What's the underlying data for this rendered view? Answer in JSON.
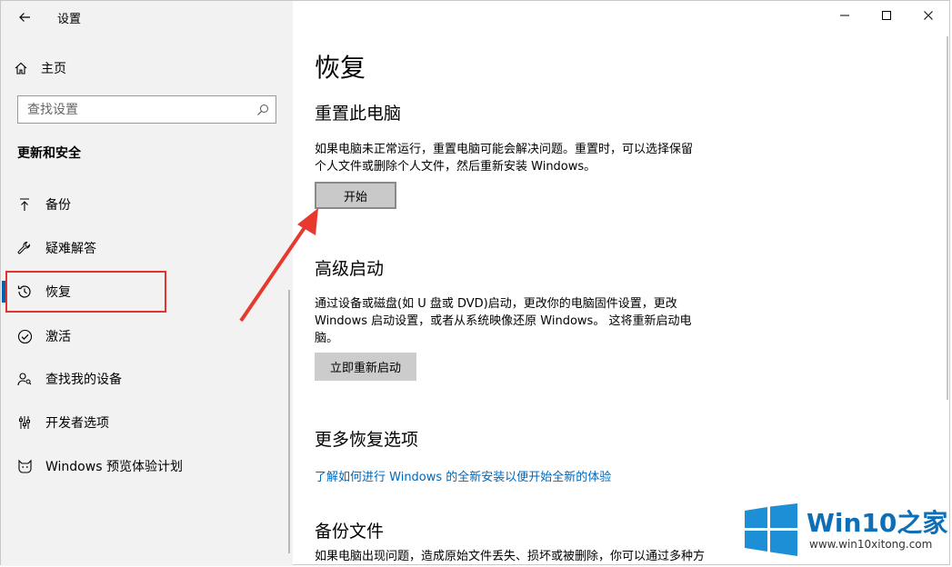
{
  "window": {
    "title": "设置",
    "controls": [
      "minimize",
      "maximize",
      "close"
    ]
  },
  "sidebar": {
    "home_label": "主页",
    "search_placeholder": "查找设置",
    "section_heading": "更新和安全",
    "items": [
      {
        "label": "备份",
        "icon": "backup-arrow-icon"
      },
      {
        "label": "疑难解答",
        "icon": "wrench-icon"
      },
      {
        "label": "恢复",
        "icon": "history-icon",
        "selected": true
      },
      {
        "label": "激活",
        "icon": "check-circle-icon"
      },
      {
        "label": "查找我的设备",
        "icon": "person-location-icon"
      },
      {
        "label": "开发者选项",
        "icon": "sliders-icon"
      },
      {
        "label": "Windows 预览体验计划",
        "icon": "cat-icon"
      }
    ]
  },
  "main": {
    "title": "恢复",
    "reset": {
      "heading": "重置此电脑",
      "text_line1": "如果电脑未正常运行，重置电脑可能会解决问题。重置时，可以选择保留",
      "text_line2": "个人文件或删除个人文件，然后重新安装 Windows。",
      "button": "开始"
    },
    "advanced": {
      "heading": "高级启动",
      "text_line1": "通过设备或磁盘(如 U 盘或 DVD)启动，更改你的电脑固件设置，更改",
      "text_line2": "Windows 启动设置，或者从系统映像还原 Windows。 这将重新启动电",
      "text_line3": "脑。",
      "button": "立即重新启动"
    },
    "more": {
      "heading": "更多恢复选项",
      "link": "了解如何进行 Windows 的全新安装以便开始全新的体验"
    },
    "backup": {
      "heading": "备份文件",
      "text_line1": "如果电脑出现问题，造成原始文件丢失、损坏或被删除，你可以通过多种方"
    }
  },
  "watermark": {
    "brand": "Win10",
    "brand_suffix": "之家",
    "url": "www.win10xitong.com",
    "color": "#0f6fb6"
  },
  "colors": {
    "accent": "#0063b1",
    "link": "#0067b8",
    "highlight": "#e0342e",
    "sidebar_bg": "#f2f2f2"
  }
}
